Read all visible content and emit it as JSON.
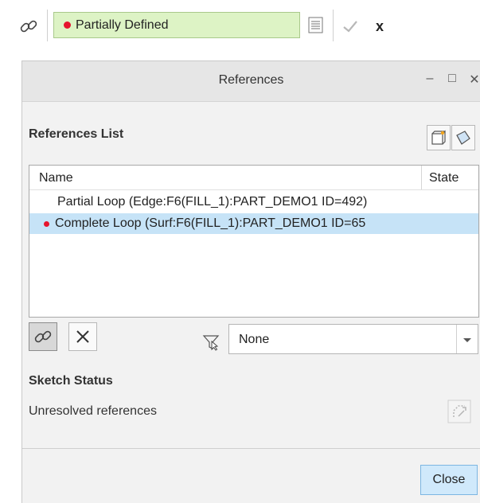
{
  "topbar": {
    "status_text": "Partially Defined",
    "status_color": "#e6142e",
    "field_bg": "#ddf3c5",
    "icons": [
      "link-chain-icon",
      "list-icon",
      "checkmark-icon",
      "close-icon"
    ]
  },
  "dialog": {
    "title": "References",
    "window_controls": [
      "minimize-icon",
      "maximize-icon",
      "close-icon"
    ],
    "references_list": {
      "label": "References List",
      "columns": [
        "Name",
        "State"
      ],
      "rows": [
        {
          "name": "Partial Loop (Edge:F6(FILL_1):PART_DEMO1 ID=492)",
          "state": "",
          "selected": false,
          "marked": false
        },
        {
          "name": "Complete Loop (Surf:F6(FILL_1):PART_DEMO1 ID=65",
          "state": "",
          "selected": true,
          "marked": true
        }
      ]
    },
    "filter": {
      "selected": "None"
    },
    "sketch_status": {
      "label": "Sketch Status",
      "text": "Unresolved references"
    },
    "close_label": "Close",
    "accent": "#c6e3f7"
  }
}
